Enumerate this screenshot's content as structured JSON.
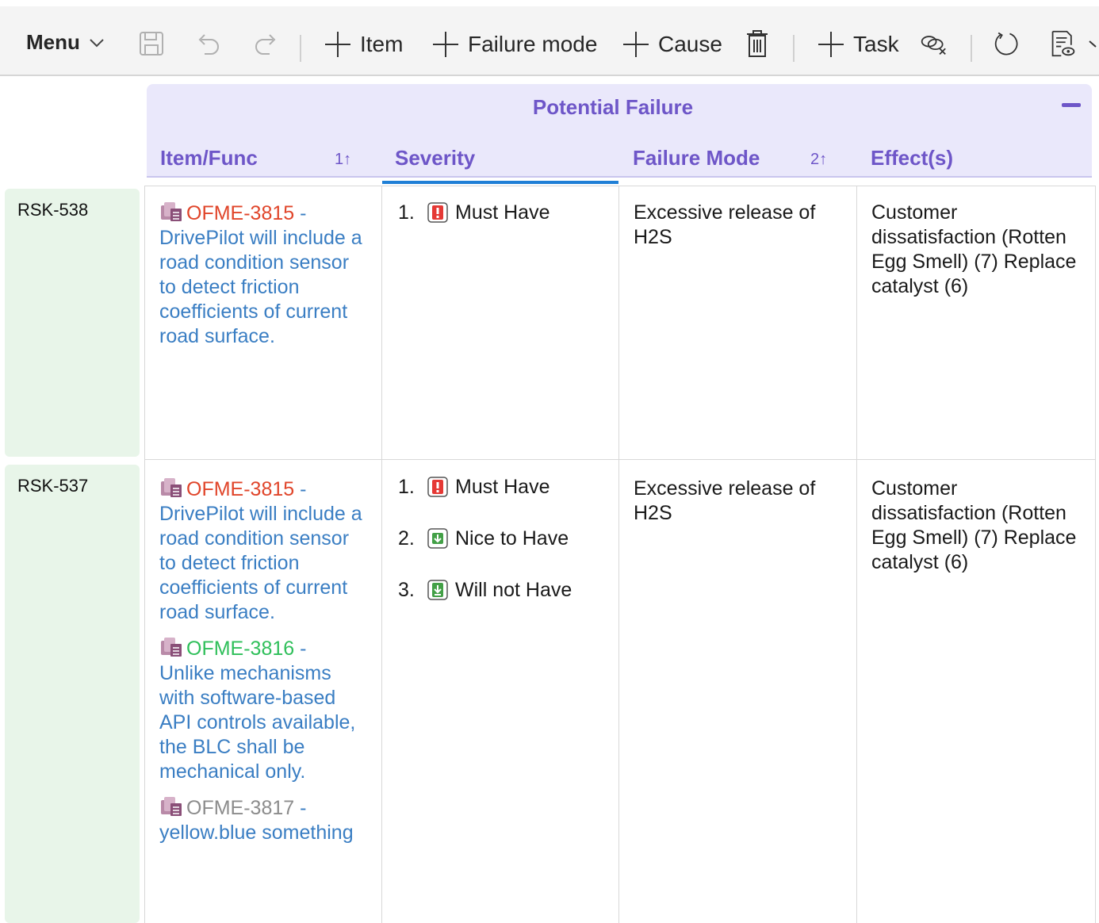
{
  "toolbar": {
    "menu_label": "Menu",
    "item_label": "Item",
    "failure_mode_label": "Failure mode",
    "cause_label": "Cause",
    "task_label": "Task"
  },
  "header": {
    "group_title": "Potential Failure",
    "columns": [
      {
        "label": "Item/Func",
        "sort": "1↑"
      },
      {
        "label": "Severity",
        "sort": ""
      },
      {
        "label": "Failure Mode",
        "sort": "2↑"
      },
      {
        "label": "Effect(s)",
        "sort": ""
      }
    ]
  },
  "rows": [
    {
      "id": "RSK-538",
      "items": [
        {
          "id": "OFME-3815",
          "sep": " -",
          "text": "DrivePilot will include a road condition sensor to detect friction coefficients of current road surface.",
          "id_color": "#e0452a"
        }
      ],
      "severity": [
        {
          "num": "1.",
          "label": "Must Have",
          "icon": "must-have-icon"
        }
      ],
      "failure_mode": "Excessive release of H2S",
      "effects": "Customer dissatisfaction (Rotten Egg Smell) (7) Replace catalyst (6)"
    },
    {
      "id": "RSK-537",
      "items": [
        {
          "id": "OFME-3815",
          "sep": " -",
          "text": "DrivePilot will include a road condition sensor to detect friction coefficients of current road surface.",
          "id_color": "#e0452a"
        },
        {
          "id": "OFME-3816",
          "sep": " -",
          "text": "Unlike mechanisms with software-based API controls available, the BLC shall be mechanical only.",
          "id_color": "#2fbf5a"
        },
        {
          "id": "OFME-3817",
          "sep": " -",
          "text": "yellow.blue something",
          "id_color": "#8c8c8c"
        }
      ],
      "severity": [
        {
          "num": "1.",
          "label": "Must Have",
          "icon": "must-have-icon"
        },
        {
          "num": "2.",
          "label": "Nice to Have",
          "icon": "nice-to-have-icon"
        },
        {
          "num": "3.",
          "label": "Will not Have",
          "icon": "will-not-have-icon"
        }
      ],
      "failure_mode": "Excessive release of H2S",
      "effects": "Customer dissatisfaction (Rotten Egg Smell) (7) Replace catalyst (6)"
    }
  ],
  "colors": {
    "accent": "#6e56c8",
    "header_bg": "#eae8fb",
    "row_label_bg": "#e8f5e9",
    "link": "#3a7ec3",
    "active_tab": "#1f7fd6"
  }
}
